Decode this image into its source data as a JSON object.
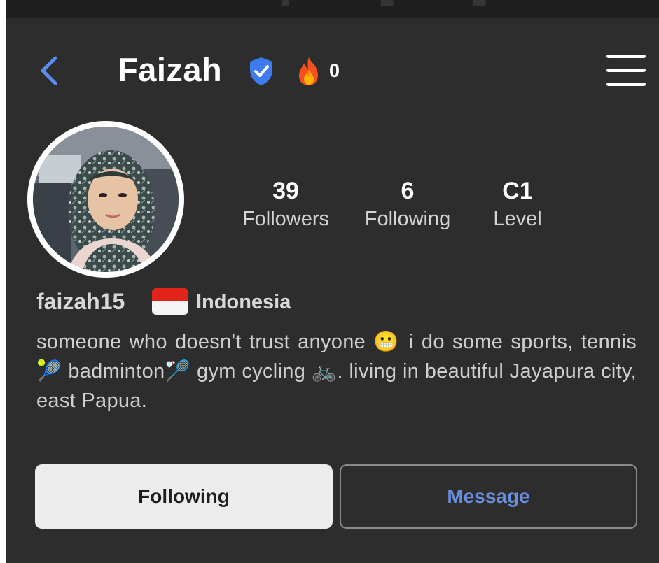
{
  "header": {
    "title": "Faizah",
    "streak_count": "0"
  },
  "stats": [
    {
      "value": "39",
      "label": "Followers"
    },
    {
      "value": "6",
      "label": "Following"
    },
    {
      "value": "C1",
      "label": "Level"
    }
  ],
  "profile": {
    "username": "faizah15",
    "country": "Indonesia",
    "bio": "someone who doesn't trust anyone 😬 i do some sports, tennis 🎾 badminton🏸 gym cycling 🚲. living in beautiful Jayapura city, east Papua."
  },
  "actions": {
    "following_label": "Following",
    "message_label": "Message"
  },
  "icons": {
    "back": "chevron-left-icon",
    "verified": "verified-shield-icon",
    "fire": "fire-icon",
    "menu": "hamburger-menu-icon",
    "flag": "indonesia-flag-icon"
  },
  "colors": {
    "background": "#2d2d2d",
    "accent": "#5b8def",
    "verified": "#3f7bf0",
    "following_button": "#ececec",
    "message_text": "#6b8fe0"
  }
}
